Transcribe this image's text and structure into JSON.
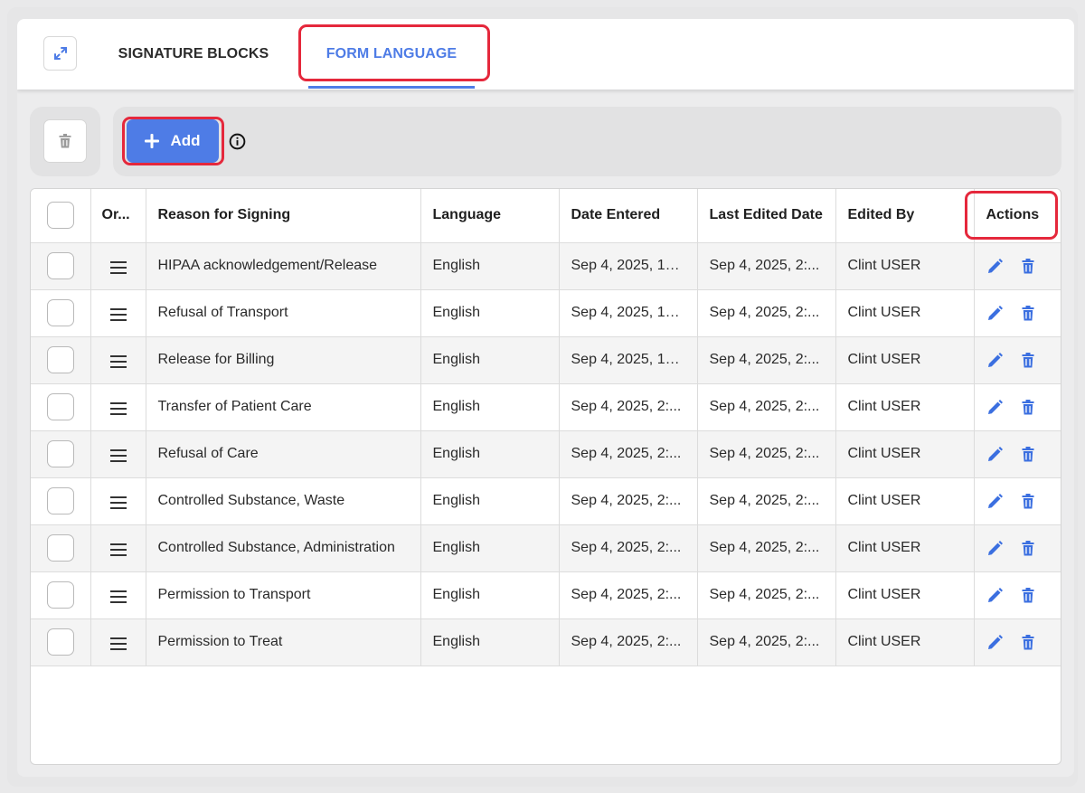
{
  "tabs": [
    {
      "label": "SIGNATURE BLOCKS",
      "active": false
    },
    {
      "label": "FORM LANGUAGE",
      "active": true
    }
  ],
  "toolbar": {
    "add_label": "Add"
  },
  "table": {
    "columns": [
      "Or...",
      "Reason for Signing",
      "Language",
      "Date Entered",
      "Last Edited Date",
      "Edited By",
      "Actions"
    ],
    "rows": [
      {
        "reason": "HIPAA acknowledgement/Release",
        "language": "English",
        "date_entered": "Sep 4, 2025, 10...",
        "last_edited": "Sep 4, 2025, 2:...",
        "edited_by": "Clint USER"
      },
      {
        "reason": "Refusal of Transport",
        "language": "English",
        "date_entered": "Sep 4, 2025, 10...",
        "last_edited": "Sep 4, 2025, 2:...",
        "edited_by": "Clint USER"
      },
      {
        "reason": "Release for Billing",
        "language": "English",
        "date_entered": "Sep 4, 2025, 10...",
        "last_edited": "Sep 4, 2025, 2:...",
        "edited_by": "Clint USER"
      },
      {
        "reason": "Transfer of Patient Care",
        "language": "English",
        "date_entered": "Sep 4, 2025, 2:...",
        "last_edited": "Sep 4, 2025, 2:...",
        "edited_by": "Clint USER"
      },
      {
        "reason": "Refusal of Care",
        "language": "English",
        "date_entered": "Sep 4, 2025, 2:...",
        "last_edited": "Sep 4, 2025, 2:...",
        "edited_by": "Clint USER"
      },
      {
        "reason": "Controlled Substance, Waste",
        "language": "English",
        "date_entered": "Sep 4, 2025, 2:...",
        "last_edited": "Sep 4, 2025, 2:...",
        "edited_by": "Clint USER"
      },
      {
        "reason": "Controlled Substance, Administration",
        "language": "English",
        "date_entered": "Sep 4, 2025, 2:...",
        "last_edited": "Sep 4, 2025, 2:...",
        "edited_by": "Clint USER"
      },
      {
        "reason": "Permission to Transport",
        "language": "English",
        "date_entered": "Sep 4, 2025, 2:...",
        "last_edited": "Sep 4, 2025, 2:...",
        "edited_by": "Clint USER"
      },
      {
        "reason": "Permission to Treat",
        "language": "English",
        "date_entered": "Sep 4, 2025, 2:...",
        "last_edited": "Sep 4, 2025, 2:...",
        "edited_by": "Clint USER"
      }
    ]
  },
  "icons": {
    "expand": "expand-icon",
    "trash": "trash-icon",
    "plus": "plus-icon",
    "info": "info-icon",
    "drag": "drag-handle-icon",
    "edit": "pencil-icon",
    "delete": "trash-icon"
  },
  "colors": {
    "accent": "#4e7ce6",
    "highlight": "#e5283c",
    "row_alt": "#f4f4f4"
  }
}
